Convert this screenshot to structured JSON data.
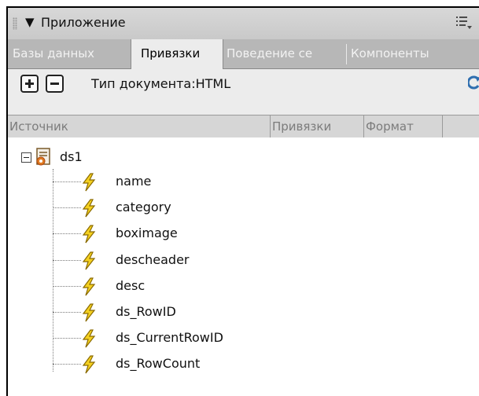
{
  "panel": {
    "title": "Приложение",
    "title_arrow": "▼"
  },
  "tabs": [
    {
      "label": "Базы данных",
      "active": false
    },
    {
      "label": "Привязки",
      "active": true
    },
    {
      "label": "Поведение се",
      "active": false
    },
    {
      "label": "Компоненты",
      "active": false
    }
  ],
  "toolbar": {
    "add_icon": "plus-icon",
    "remove_icon": "minus-icon",
    "document_type": "Тип документа:HTML",
    "refresh_icon": "refresh-icon"
  },
  "table": {
    "columns": [
      "Источник",
      "Привязки",
      "Формат"
    ]
  },
  "tree": {
    "root": {
      "label": "ds1",
      "expanded": true,
      "icon": "dataset-icon",
      "children": [
        {
          "label": "name",
          "icon": "bolt-icon"
        },
        {
          "label": "category",
          "icon": "bolt-icon"
        },
        {
          "label": "boximage",
          "icon": "bolt-icon"
        },
        {
          "label": "descheader",
          "icon": "bolt-icon"
        },
        {
          "label": "desc",
          "icon": "bolt-icon"
        },
        {
          "label": "ds_RowID",
          "icon": "bolt-icon"
        },
        {
          "label": "ds_CurrentRowID",
          "icon": "bolt-icon"
        },
        {
          "label": "ds_RowCount",
          "icon": "bolt-icon"
        }
      ]
    }
  },
  "colors": {
    "bolt_fill": "#f4d020",
    "bolt_stroke": "#8a6a00",
    "dataset_orange": "#e07a20",
    "refresh_blue": "#2f6fb0"
  }
}
